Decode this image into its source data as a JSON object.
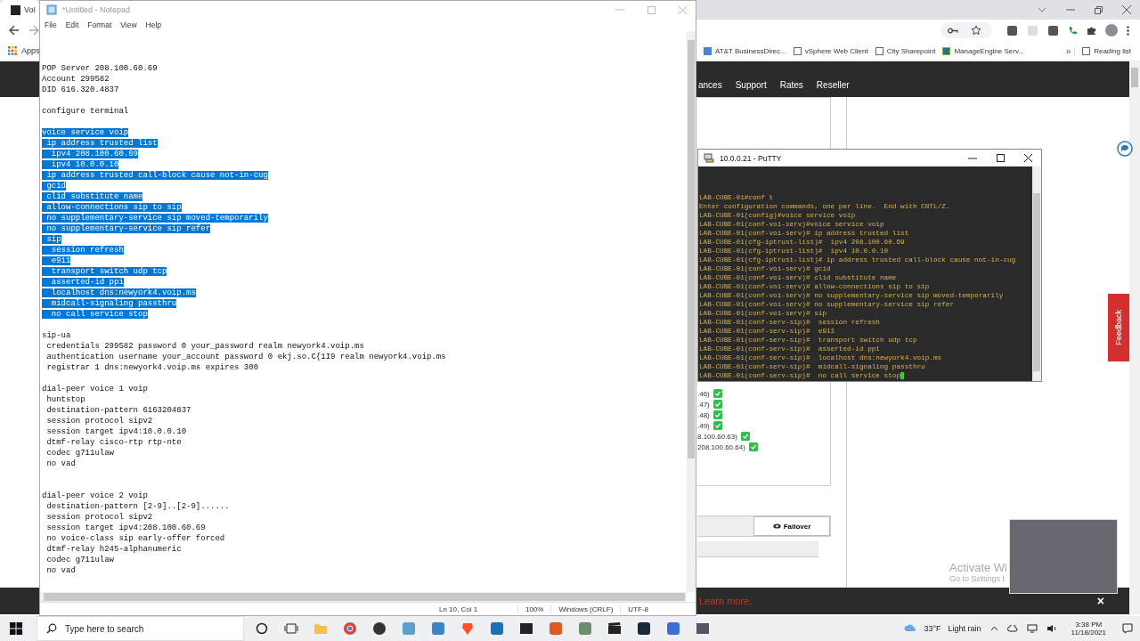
{
  "browser": {
    "tab_title": "VoI",
    "apps": "Apps",
    "bookmarks": [
      {
        "label": "AT&T BusinessDirec..."
      },
      {
        "label": "vSphere Web Client"
      },
      {
        "label": "City Sharepoint"
      },
      {
        "label": "ManageEngine Serv..."
      }
    ],
    "overflow": "»",
    "reading_list": "Reading list",
    "nav": [
      "ances",
      "Support",
      "Rates",
      "Reseller"
    ],
    "status_items": [
      {
        "label": ".46)",
        "checked": true
      },
      {
        "label": ".47)",
        "checked": true
      },
      {
        "label": ".48)",
        "checked": true
      },
      {
        "label": ".49)",
        "checked": true
      },
      {
        "label": "8.100.60.63)",
        "checked": true
      },
      {
        "label": "208.100.60.64)",
        "checked": true
      }
    ],
    "failover_button": "Failover",
    "feedback": "Feedback",
    "cookie_link": "Learn more.",
    "cookie_close": "×"
  },
  "notepad": {
    "title": "*Untitled - Notepad",
    "menu": [
      "File",
      "Edit",
      "Format",
      "View",
      "Help"
    ],
    "lines": [
      {
        "kind": "blank"
      },
      {
        "kind": "blank"
      },
      {
        "kind": "blank"
      },
      {
        "kind": "text",
        "text": "POP Server 208.100.60.69",
        "selected": false
      },
      {
        "kind": "text",
        "text": "Account 299582",
        "selected": false
      },
      {
        "kind": "text",
        "text": "DID 616.320.4837",
        "selected": false
      },
      {
        "kind": "blank"
      },
      {
        "kind": "text",
        "text": "configure terminal",
        "selected": false
      },
      {
        "kind": "blank"
      },
      {
        "kind": "text",
        "text": "voice service voip",
        "selected": true
      },
      {
        "kind": "text",
        "text": " ip address trusted list",
        "selected": true
      },
      {
        "kind": "text",
        "text": "  ipv4 208.100.60.69",
        "selected": true
      },
      {
        "kind": "text",
        "text": "  ipv4 10.0.0.10",
        "selected": true
      },
      {
        "kind": "text",
        "text": " ip address trusted call-block cause not-in-cug",
        "selected": true
      },
      {
        "kind": "text",
        "text": " gcid",
        "selected": true
      },
      {
        "kind": "text",
        "text": " clid substitute name",
        "selected": true
      },
      {
        "kind": "text",
        "text": " allow-connections sip to sip",
        "selected": true
      },
      {
        "kind": "text",
        "text": " no supplementary-service sip moved-temporarily",
        "selected": true
      },
      {
        "kind": "text",
        "text": " no supplementary-service sip refer",
        "selected": true
      },
      {
        "kind": "text",
        "text": " sip",
        "selected": true
      },
      {
        "kind": "text",
        "text": "  session refresh",
        "selected": true
      },
      {
        "kind": "text",
        "text": "  e911",
        "selected": true
      },
      {
        "kind": "text",
        "text": "  transport switch udp tcp",
        "selected": true
      },
      {
        "kind": "text",
        "text": "  asserted-id ppi",
        "selected": true
      },
      {
        "kind": "text",
        "text": "  localhost dns:newyork4.voip.ms",
        "selected": true
      },
      {
        "kind": "text",
        "text": "  midcall-signaling passthru",
        "selected": true
      },
      {
        "kind": "text",
        "text": "  no call service stop",
        "selected": true
      },
      {
        "kind": "blank"
      },
      {
        "kind": "text",
        "text": "sip-ua",
        "selected": false
      },
      {
        "kind": "text",
        "text": " credentials 299582 password 0 your_password realm newyork4.voip.ms",
        "selected": false
      },
      {
        "kind": "text",
        "text": " authentication username your_account password 0 ekj.so.C{1I9 realm newyork4.voip.ms",
        "selected": false
      },
      {
        "kind": "text",
        "text": " registrar 1 dns:newyork4.voip.ms expires 300",
        "selected": false
      },
      {
        "kind": "blank"
      },
      {
        "kind": "text",
        "text": "dial-peer voice 1 voip",
        "selected": false
      },
      {
        "kind": "text",
        "text": " huntstop",
        "selected": false
      },
      {
        "kind": "text",
        "text": " destination-pattern 6163204837",
        "selected": false
      },
      {
        "kind": "text",
        "text": " session protocol sipv2",
        "selected": false
      },
      {
        "kind": "text",
        "text": " session target ipv4:10.0.0.10",
        "selected": false
      },
      {
        "kind": "text",
        "text": " dtmf-relay cisco-rtp rtp-nte",
        "selected": false
      },
      {
        "kind": "text",
        "text": " codec g711ulaw",
        "selected": false
      },
      {
        "kind": "text",
        "text": " no vad",
        "selected": false
      },
      {
        "kind": "blank"
      },
      {
        "kind": "blank"
      },
      {
        "kind": "text",
        "text": "dial-peer voice 2 voip",
        "selected": false
      },
      {
        "kind": "text",
        "text": " destination-pattern [2-9]..[2-9]......",
        "selected": false
      },
      {
        "kind": "text",
        "text": " session protocol sipv2",
        "selected": false
      },
      {
        "kind": "text",
        "text": " session target ipv4:208.100.60.69",
        "selected": false
      },
      {
        "kind": "text",
        "text": " no voice-class sip early-offer forced",
        "selected": false
      },
      {
        "kind": "text",
        "text": " dtmf-relay h245-alphanumeric",
        "selected": false
      },
      {
        "kind": "text",
        "text": " codec g711ulaw",
        "selected": false
      },
      {
        "kind": "text",
        "text": " no vad",
        "selected": false
      }
    ],
    "status": {
      "position": "Ln 10, Col 1",
      "zoom": "100%",
      "line_ending": "Windows (CRLF)",
      "encoding": "UTF-8"
    }
  },
  "putty": {
    "title": "10.0.0.21 - PuTTY",
    "cursor": true,
    "lines": [
      "LAB-CUBE-01#conf t",
      "Enter configuration commands, one per line.  End with CNTL/Z.",
      "LAB-CUBE-01(config)#voice service voip",
      "LAB-CUBE-01(conf-voi-serv)#voice service voip",
      "LAB-CUBE-01(conf-voi-serv)# ip address trusted list",
      "LAB-CUBE-01(cfg-iptrust-list)#  ipv4 208.100.60.69",
      "LAB-CUBE-01(cfg-iptrust-list)#  ipv4 10.0.0.10",
      "LAB-CUBE-01(cfg-iptrust-list)# ip address trusted call-block cause not-in-cug",
      "LAB-CUBE-01(conf-voi-serv)# gcid",
      "LAB-CUBE-01(conf-voi-serv)# clid substitute name",
      "LAB-CUBE-01(conf-voi-serv)# allow-connections sip to sip",
      "LAB-CUBE-01(conf-voi-serv)# no supplementary-service sip moved-temporarily",
      "LAB-CUBE-01(conf-voi-serv)# no supplementary-service sip refer",
      "LAB-CUBE-01(conf-voi-serv)# sip",
      "LAB-CUBE-01(conf-serv-sip)#  session refresh",
      "LAB-CUBE-01(conf-serv-sip)#  e911",
      "LAB-CUBE-01(conf-serv-sip)#  transport switch udp tcp",
      "LAB-CUBE-01(conf-serv-sip)#  asserted-id ppi",
      "LAB-CUBE-01(conf-serv-sip)#  localhost dns:newyork4.voip.ms",
      "LAB-CUBE-01(conf-serv-sip)#  midcall-signaling passthru",
      "LAB-CUBE-01(conf-serv-sip)#  no call service stop"
    ]
  },
  "activation_notice": {
    "title": "Activate Wi",
    "subtitle": "Go to Settings t"
  },
  "taskbar": {
    "search_placeholder": "Type here to search",
    "temperature": "33°F",
    "condition": "Light rain",
    "time": "3:38 PM",
    "date": "11/18/2021"
  }
}
